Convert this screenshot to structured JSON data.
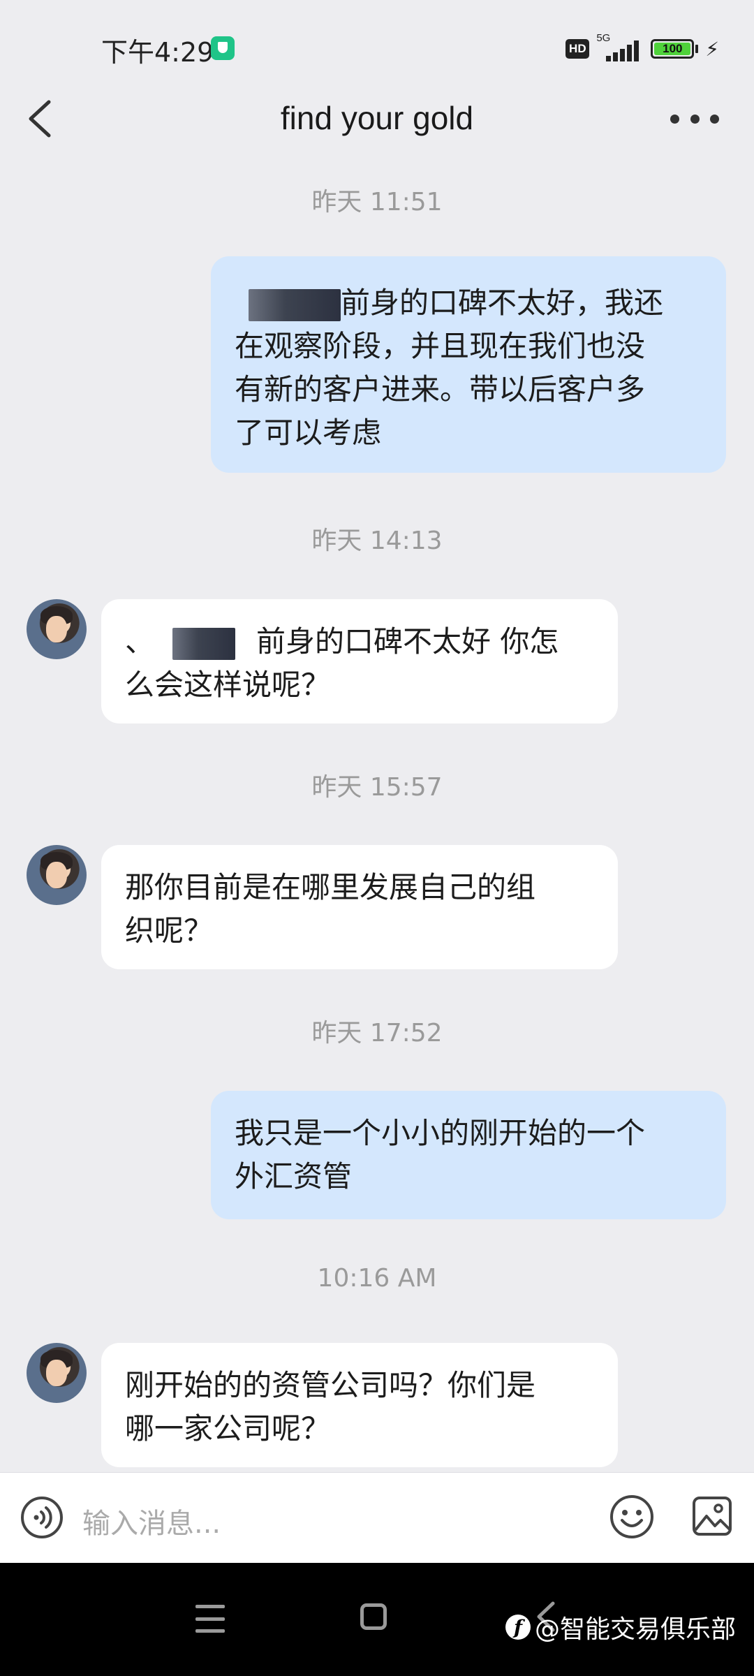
{
  "status_bar": {
    "time": "下午4:29",
    "hd": "HD",
    "network": "5G",
    "battery": "100"
  },
  "header": {
    "title": "find your gold"
  },
  "messages": [
    {
      "timestamp": "昨天 11:51"
    },
    {
      "sender": "me",
      "text_after_redaction": "前身的口碑不太好，我还在观察阶段，并且现在我们也没有新的客户进来。带以后客户多了可以考虑",
      "lines": [
        "前身的口碑不太好，我还",
        "在观察阶段，并且现在我们也没",
        "有新的客户进来。带以后客户多",
        "了可以考虑"
      ]
    },
    {
      "timestamp": "昨天 14:13"
    },
    {
      "sender": "them",
      "prefix": "、",
      "lines": [
        "前身的口碑不太好 你怎",
        "么会这样说呢？"
      ]
    },
    {
      "timestamp": "昨天 15:57"
    },
    {
      "sender": "them",
      "lines": [
        "那你目前是在哪里发展自己的组",
        "织呢？"
      ]
    },
    {
      "timestamp": "昨天 17:52"
    },
    {
      "sender": "me",
      "lines": [
        "我只是一个小小的刚开始的一个",
        "外汇资管"
      ]
    },
    {
      "timestamp": "10:16 AM"
    },
    {
      "sender": "them",
      "lines": [
        "刚开始的的资管公司吗？你们是",
        "哪一家公司呢？"
      ]
    }
  ],
  "input": {
    "placeholder": "输入消息..."
  },
  "watermark": {
    "text": "@智能交易俱乐部"
  },
  "colors": {
    "background": "#ededf0",
    "my_bubble": "#d4e7fd",
    "their_bubble": "#ffffff",
    "shield": "#1fc488",
    "battery": "#4fd13b"
  }
}
